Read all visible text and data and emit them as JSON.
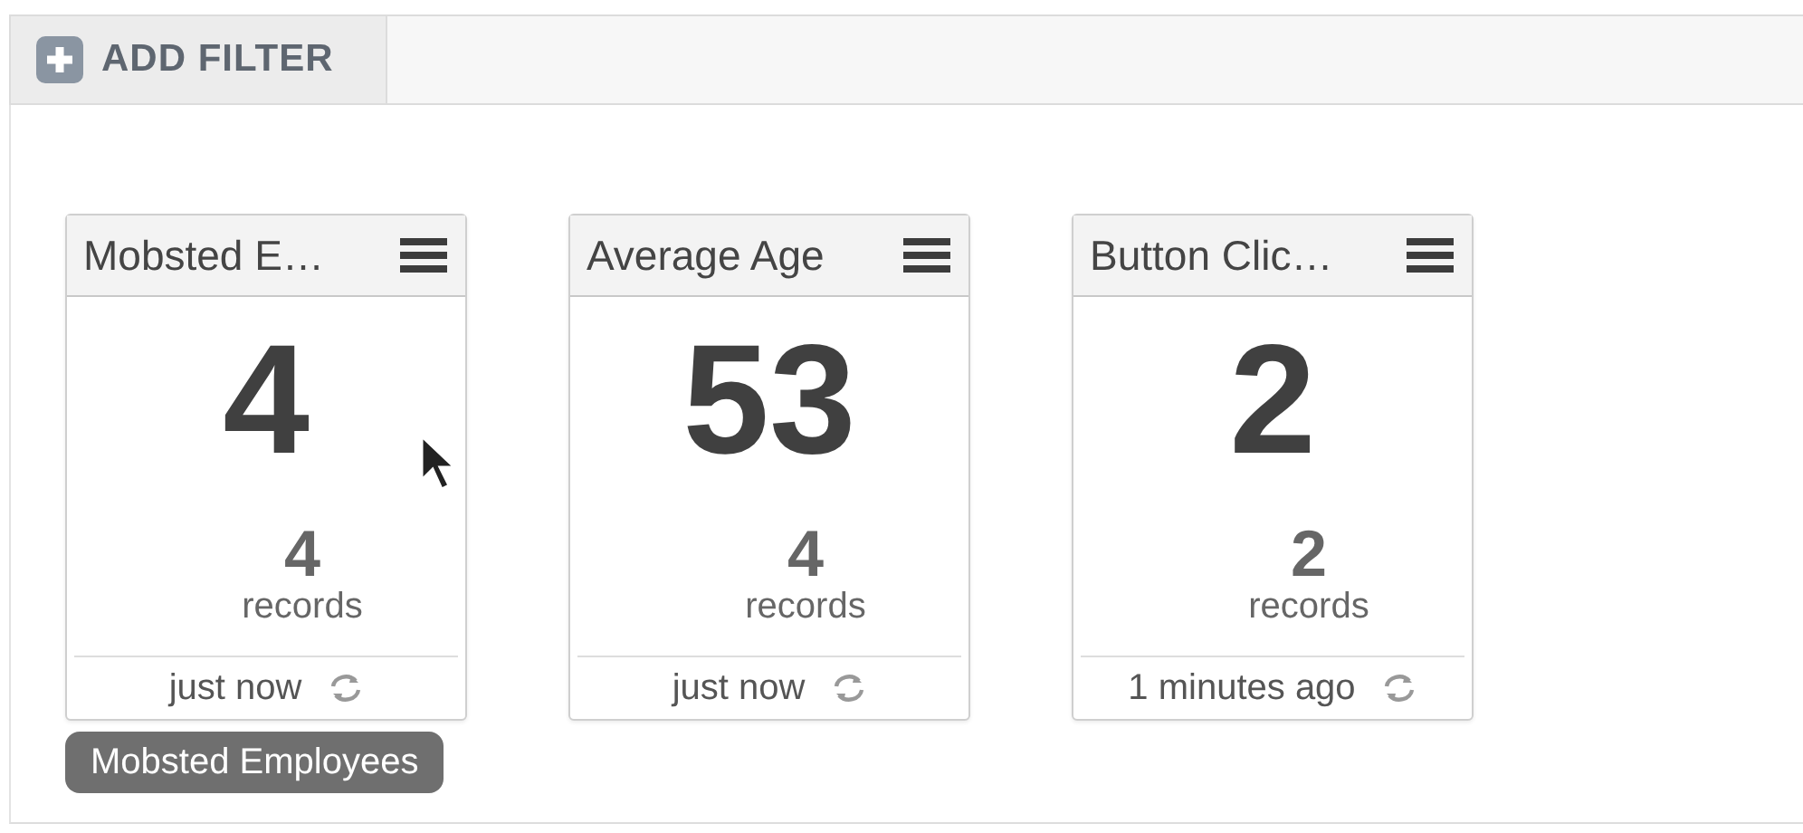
{
  "toolbar": {
    "add_filter": {
      "label": "ADD FILTER"
    }
  },
  "widgets": [
    {
      "title": "Mobsted E…",
      "value": "4",
      "count": "4",
      "count_label": "records",
      "updated": "just now",
      "tooltip": "Mobsted Employees"
    },
    {
      "title": "Average Age",
      "value": "53",
      "count": "4",
      "count_label": "records",
      "updated": "just now"
    },
    {
      "title": "Button Clic…",
      "value": "2",
      "count": "2",
      "count_label": "records",
      "updated": "1 minutes ago"
    }
  ]
}
